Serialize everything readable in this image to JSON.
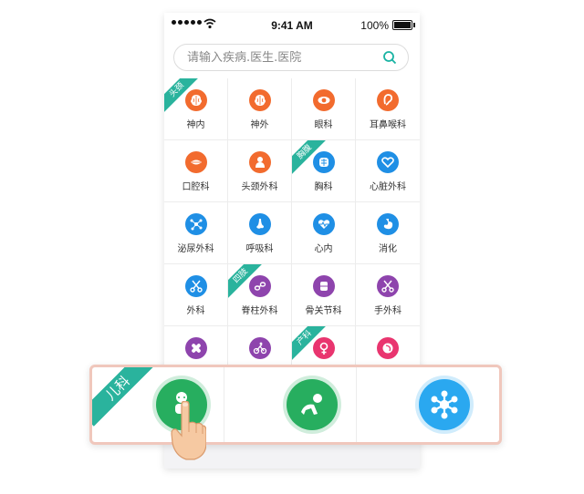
{
  "status": {
    "time": "9:41 AM",
    "battery": "100%"
  },
  "search": {
    "placeholder": "请输入疾病.医生.医院"
  },
  "grid": [
    [
      {
        "label": "神内",
        "icon": "brain-icon",
        "color": "#f26b2e",
        "ribbon": "头颈"
      },
      {
        "label": "神外",
        "icon": "brain-icon",
        "color": "#f26b2e"
      },
      {
        "label": "眼科",
        "icon": "eye-icon",
        "color": "#f26b2e"
      },
      {
        "label": "耳鼻喉科",
        "icon": "ear-icon",
        "color": "#f26b2e"
      }
    ],
    [
      {
        "label": "口腔科",
        "icon": "mouth-icon",
        "color": "#f26b2e"
      },
      {
        "label": "头颈外科",
        "icon": "head-icon",
        "color": "#f26b2e"
      },
      {
        "label": "胸科",
        "icon": "chest-icon",
        "color": "#1f8fe5",
        "ribbon": "胸腹"
      },
      {
        "label": "心脏外科",
        "icon": "heart-icon",
        "color": "#1f8fe5"
      }
    ],
    [
      {
        "label": "泌尿外科",
        "icon": "molecule-icon",
        "color": "#1f8fe5"
      },
      {
        "label": "呼吸科",
        "icon": "nose-icon",
        "color": "#1f8fe5"
      },
      {
        "label": "心内",
        "icon": "heart-pulse-icon",
        "color": "#1f8fe5"
      },
      {
        "label": "消化",
        "icon": "stomach-icon",
        "color": "#1f8fe5"
      }
    ],
    [
      {
        "label": "外科",
        "icon": "scissors-icon",
        "color": "#1f8fe5"
      },
      {
        "label": "脊柱外科",
        "icon": "spine-icon",
        "color": "#8e44ad",
        "ribbon": "四肢"
      },
      {
        "label": "骨关节科",
        "icon": "bone-icon",
        "color": "#8e44ad"
      },
      {
        "label": "手外科",
        "icon": "scissors-icon",
        "color": "#8e44ad"
      }
    ],
    [
      {
        "label": "",
        "icon": "bandage-icon",
        "color": "#8e44ad"
      },
      {
        "label": "",
        "icon": "cyclist-icon",
        "color": "#8e44ad"
      },
      {
        "label": "",
        "icon": "female-icon",
        "color": "#e9356f",
        "ribbon": "产科"
      },
      {
        "label": "",
        "icon": "pregnant-icon",
        "color": "#e9356f"
      }
    ]
  ],
  "overlay": {
    "ribbon": "儿科",
    "items": [
      {
        "icon": "baby-icon",
        "color": "#27ae5f"
      },
      {
        "icon": "crawling-baby-icon",
        "color": "#27ae5f"
      },
      {
        "icon": "virus-icon",
        "color": "#2aa8f0"
      }
    ]
  }
}
